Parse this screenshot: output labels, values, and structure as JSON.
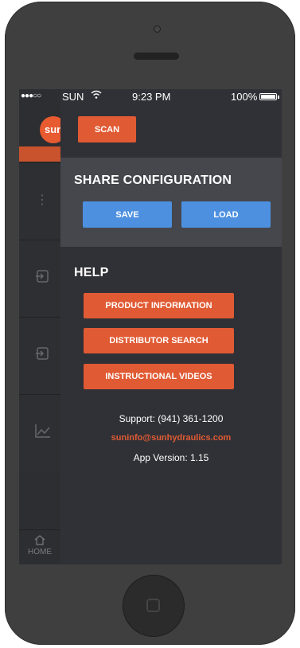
{
  "status_bar": {
    "signal": "●●●○○",
    "carrier": "SUN",
    "wifi_icon": "wifi-icon",
    "time": "9:23 PM",
    "battery": "100%"
  },
  "background_app": {
    "logo_text": "sun",
    "home_label": "HOME"
  },
  "menu": {
    "scan_label": "SCAN",
    "share": {
      "title": "SHARE CONFIGURATION",
      "save_label": "SAVE",
      "load_label": "LOAD"
    },
    "help": {
      "title": "HELP",
      "items": [
        {
          "label": "PRODUCT INFORMATION"
        },
        {
          "label": "DISTRIBUTOR SEARCH"
        },
        {
          "label": "INSTRUCTIONAL VIDEOS"
        }
      ]
    },
    "support_phone": "Support: (941) 361-1200",
    "support_email": "suninfo@sunhydraulics.com",
    "app_version": "App Version: 1.15"
  },
  "colors": {
    "accent_orange": "#e05a33",
    "accent_blue": "#4d90e0",
    "panel_bg": "#303136",
    "section_bg": "#45474c"
  }
}
